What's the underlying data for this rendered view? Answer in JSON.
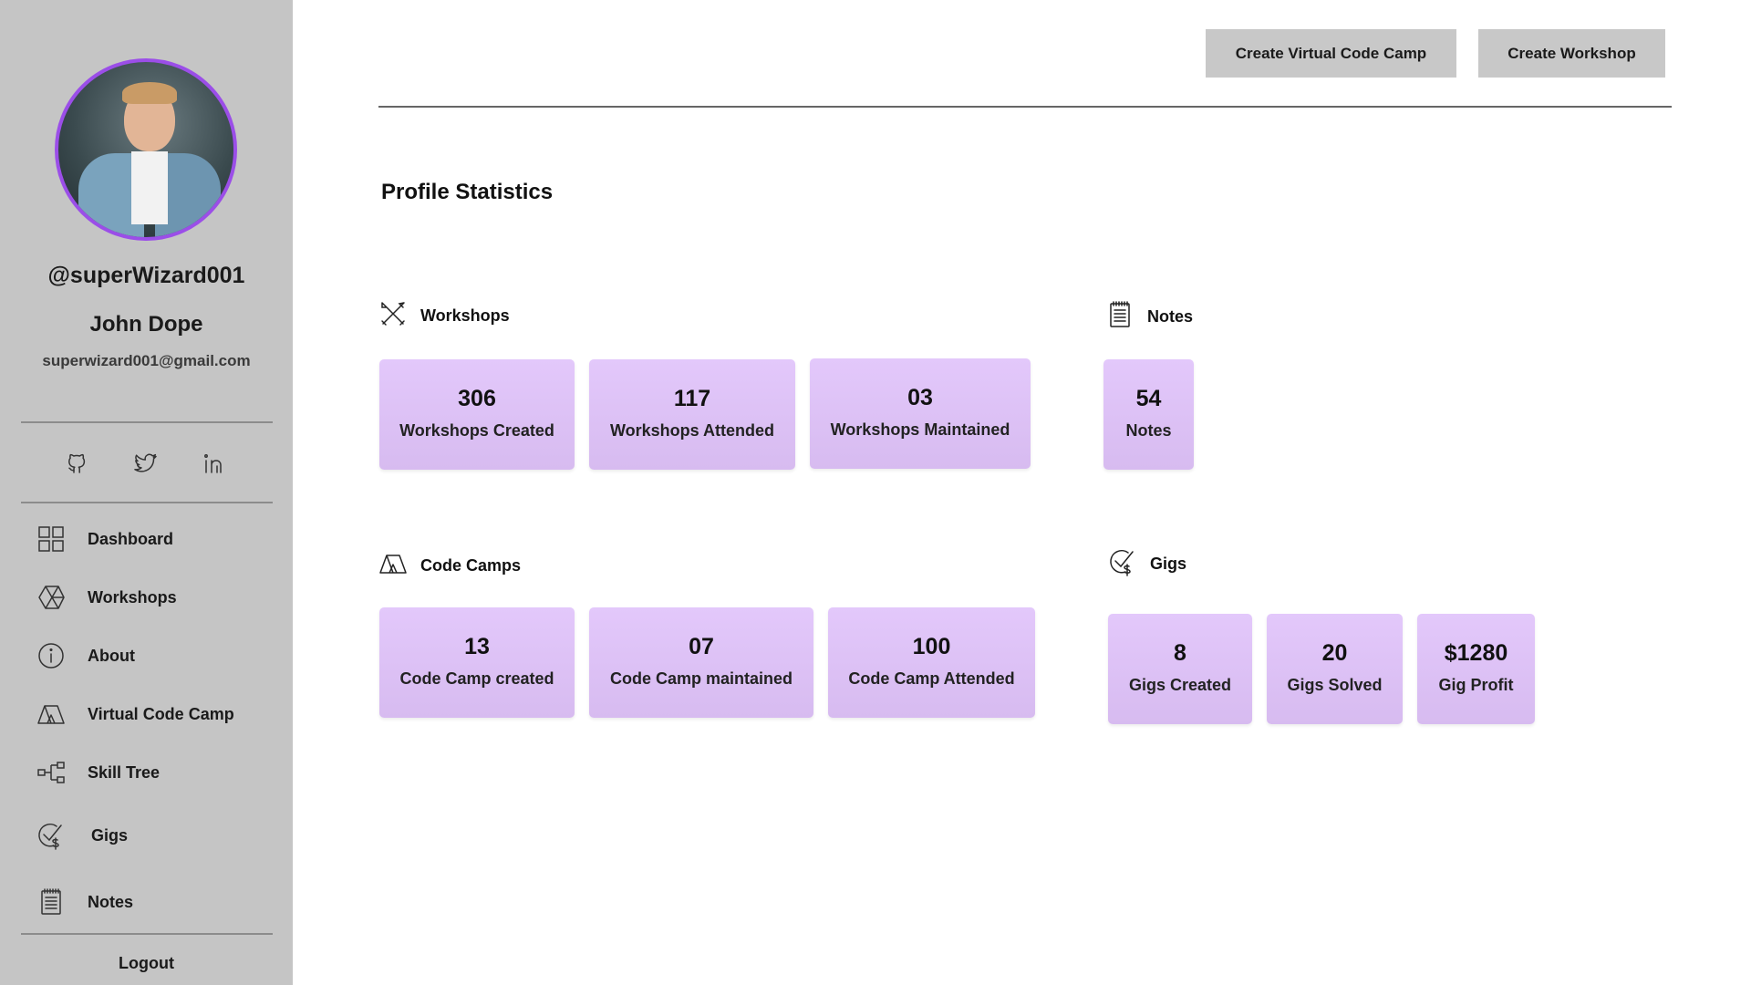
{
  "profile": {
    "username": "@superWizard001",
    "name": "John Dope",
    "email": "superwizard001@gmail.com",
    "avatar_border_color": "#9b4ee8"
  },
  "social": [
    {
      "icon": "github-icon"
    },
    {
      "icon": "twitter-icon"
    },
    {
      "icon": "linkedin-icon"
    }
  ],
  "nav": {
    "items": [
      {
        "label": "Dashboard",
        "icon": "grid-icon"
      },
      {
        "label": "Workshops",
        "icon": "workshops-icon"
      },
      {
        "label": "About",
        "icon": "info-icon"
      },
      {
        "label": "Virtual Code Camp",
        "icon": "tent-icon"
      },
      {
        "label": "Skill Tree",
        "icon": "tree-icon"
      },
      {
        "label": "Gigs",
        "icon": "gig-icon"
      },
      {
        "label": "Notes",
        "icon": "notes-icon"
      }
    ],
    "logout": "Logout"
  },
  "toolbar": {
    "create_camp": "Create Virtual Code Camp",
    "create_workshop": "Create Workshop"
  },
  "page_title": "Profile Statistics",
  "sections": {
    "workshops": {
      "title": "Workshops",
      "cards": [
        {
          "value": "306",
          "label": "Workshops Created"
        },
        {
          "value": "117",
          "label": "Workshops Attended"
        },
        {
          "value": "03",
          "label": "Workshops Maintained"
        }
      ]
    },
    "notes": {
      "title": "Notes",
      "cards": [
        {
          "value": "54",
          "label": "Notes"
        }
      ]
    },
    "code_camps": {
      "title": "Code Camps",
      "cards": [
        {
          "value": "13",
          "label": "Code Camp created"
        },
        {
          "value": "07",
          "label": "Code Camp maintained"
        },
        {
          "value": "100",
          "label": "Code Camp Attended"
        }
      ]
    },
    "gigs": {
      "title": "Gigs",
      "cards": [
        {
          "value": "8",
          "label": "Gigs Created"
        },
        {
          "value": "20",
          "label": "Gigs Solved"
        },
        {
          "value": "$1280",
          "label": "Gig Profit"
        }
      ]
    }
  },
  "colors": {
    "sidebar_bg": "#c5c5c5",
    "card_bg": "#dfc3f8",
    "button_bg": "#c8c8c8"
  }
}
